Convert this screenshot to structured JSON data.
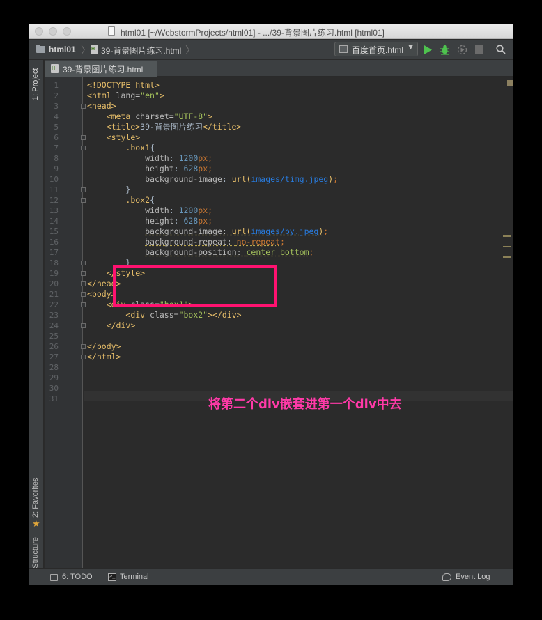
{
  "window": {
    "title": "html01 [~/WebstormProjects/html01] - .../39-背景图片练习.html [html01]"
  },
  "navbar": {
    "project": "html01",
    "file": "39-背景图片练习.html",
    "run_config": "百度首页.html",
    "separator": "〉"
  },
  "tool_windows": {
    "project": "1: Project",
    "favorites": "2: Favorites",
    "structure": "7: Structure"
  },
  "editor_tab": {
    "label": "39-背景图片练习.html"
  },
  "code": {
    "line_numbers": [
      "1",
      "2",
      "3",
      "4",
      "5",
      "6",
      "7",
      "8",
      "9",
      "10",
      "11",
      "12",
      "13",
      "14",
      "15",
      "16",
      "17",
      "18",
      "19",
      "20",
      "21",
      "22",
      "23",
      "24",
      "25",
      "26",
      "27",
      "28",
      "29",
      "30",
      "31"
    ],
    "lines": [
      {
        "n": 1,
        "tokens": [
          [
            "tag",
            "<!DOCTYPE html>"
          ]
        ]
      },
      {
        "n": 2,
        "tokens": [
          [
            "tag",
            "<html "
          ],
          [
            "attr",
            "lang="
          ],
          [
            "str",
            "\"en\""
          ],
          [
            "tag",
            ">"
          ]
        ]
      },
      {
        "n": 3,
        "tokens": [
          [
            "tag",
            "<head>"
          ]
        ]
      },
      {
        "n": 4,
        "tokens": [
          [
            "txt",
            "    "
          ],
          [
            "tag",
            "<meta "
          ],
          [
            "attr",
            "charset="
          ],
          [
            "str",
            "\"UTF-8\""
          ],
          [
            "tag",
            ">"
          ]
        ]
      },
      {
        "n": 5,
        "tokens": [
          [
            "txt",
            "    "
          ],
          [
            "tag",
            "<title>"
          ],
          [
            "txt",
            "39-背景图片练习"
          ],
          [
            "tag",
            "</title>"
          ]
        ]
      },
      {
        "n": 6,
        "tokens": [
          [
            "txt",
            "    "
          ],
          [
            "tag",
            "<style>"
          ]
        ]
      },
      {
        "n": 7,
        "tokens": [
          [
            "txt",
            "        "
          ],
          [
            "sel",
            ".box1"
          ],
          [
            "txt",
            "{"
          ]
        ]
      },
      {
        "n": 8,
        "tokens": [
          [
            "txt",
            "            "
          ],
          [
            "prop",
            "width"
          ],
          [
            "txt",
            ": "
          ],
          [
            "num",
            "1200"
          ],
          [
            "unit",
            "px"
          ],
          [
            "punct",
            ";"
          ]
        ]
      },
      {
        "n": 9,
        "tokens": [
          [
            "txt",
            "            "
          ],
          [
            "prop",
            "height"
          ],
          [
            "txt",
            ": "
          ],
          [
            "num",
            "628"
          ],
          [
            "unit",
            "px"
          ],
          [
            "punct",
            ";"
          ]
        ]
      },
      {
        "n": 10,
        "tokens": [
          [
            "txt",
            "            "
          ],
          [
            "prop",
            "background-image"
          ],
          [
            "txt",
            ": "
          ],
          [
            "fn",
            "url("
          ],
          [
            "url",
            "images/timg.jpeg"
          ],
          [
            "fn",
            ")"
          ],
          [
            "punct",
            ";"
          ]
        ]
      },
      {
        "n": 11,
        "tokens": [
          [
            "txt",
            "        }"
          ]
        ]
      },
      {
        "n": 12,
        "tokens": [
          [
            "txt",
            "        "
          ],
          [
            "sel",
            ".box2"
          ],
          [
            "txt",
            "{"
          ]
        ]
      },
      {
        "n": 13,
        "tokens": [
          [
            "txt",
            "            "
          ],
          [
            "prop",
            "width"
          ],
          [
            "txt",
            ": "
          ],
          [
            "num",
            "1200"
          ],
          [
            "unit",
            "px"
          ],
          [
            "punct",
            ";"
          ]
        ]
      },
      {
        "n": 14,
        "tokens": [
          [
            "txt",
            "            "
          ],
          [
            "prop",
            "height"
          ],
          [
            "txt",
            ": "
          ],
          [
            "num",
            "628"
          ],
          [
            "unit",
            "px"
          ],
          [
            "punct",
            ";"
          ]
        ]
      },
      {
        "n": 15,
        "tokens": [
          [
            "txt",
            "            "
          ],
          [
            "prop warn",
            "background-image: "
          ],
          [
            "fn warn",
            "url("
          ],
          [
            "url warn",
            "images/by.jpeg"
          ],
          [
            "fn warn",
            ")"
          ],
          [
            "punct",
            ";"
          ]
        ]
      },
      {
        "n": 16,
        "tokens": [
          [
            "txt",
            "            "
          ],
          [
            "prop warn",
            "background-repeat: "
          ],
          [
            "unit warn",
            "no-repeat"
          ],
          [
            "punct",
            ";"
          ]
        ]
      },
      {
        "n": 17,
        "tokens": [
          [
            "txt",
            "            "
          ],
          [
            "prop warn",
            "background-position: "
          ],
          [
            "str warn",
            "center bottom"
          ],
          [
            "punct",
            ";"
          ]
        ]
      },
      {
        "n": 18,
        "tokens": [
          [
            "txt",
            "        }"
          ]
        ]
      },
      {
        "n": 19,
        "tokens": [
          [
            "txt",
            "    "
          ],
          [
            "tag",
            "</style>"
          ]
        ]
      },
      {
        "n": 20,
        "tokens": [
          [
            "tag",
            "</head>"
          ]
        ]
      },
      {
        "n": 21,
        "tokens": [
          [
            "tag",
            "<body>"
          ]
        ]
      },
      {
        "n": 22,
        "tokens": [
          [
            "txt",
            "    "
          ],
          [
            "tag",
            "<div "
          ],
          [
            "attr",
            "class="
          ],
          [
            "str",
            "\"box1\""
          ],
          [
            "tag",
            ">"
          ]
        ]
      },
      {
        "n": 23,
        "tokens": [
          [
            "txt",
            "        "
          ],
          [
            "tag",
            "<div "
          ],
          [
            "attr",
            "class="
          ],
          [
            "str",
            "\"box2\""
          ],
          [
            "tag",
            "></div>"
          ]
        ]
      },
      {
        "n": 24,
        "tokens": [
          [
            "txt",
            "    "
          ],
          [
            "tag",
            "</div>"
          ]
        ]
      },
      {
        "n": 25,
        "tokens": []
      },
      {
        "n": 26,
        "tokens": [
          [
            "tag",
            "</body>"
          ]
        ]
      },
      {
        "n": 27,
        "tokens": [
          [
            "tag",
            "</html>"
          ]
        ]
      },
      {
        "n": 28,
        "tokens": []
      },
      {
        "n": 29,
        "tokens": []
      },
      {
        "n": 30,
        "tokens": []
      },
      {
        "n": 31,
        "tokens": []
      }
    ]
  },
  "annotation": {
    "text": "将第二个div嵌套进第一个div中去",
    "color": "#ff1270"
  },
  "statusbar": {
    "todo_key": "6",
    "todo_label": ": TODO",
    "terminal": "Terminal",
    "event_log": "Event Log"
  },
  "icons": {
    "run": "run-icon",
    "debug": "debug-icon",
    "coverage": "coverage-icon",
    "stop": "stop-icon",
    "search": "search-icon"
  },
  "colors": {
    "editor_bg": "#2b2b2b",
    "tag": "#e8bf6a",
    "string": "#a5c25c",
    "number": "#6897bb",
    "keyword": "#cc7832",
    "url": "#287bde",
    "run_green": "#4ec24e"
  }
}
